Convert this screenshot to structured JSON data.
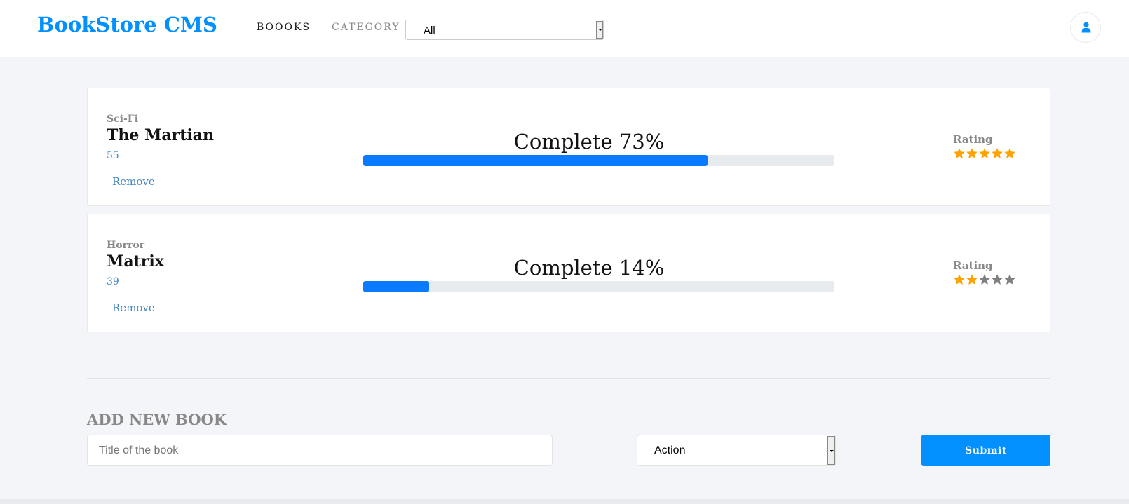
{
  "header": {
    "brand": "BookStore CMS",
    "nav_books": "BOOOKS",
    "nav_category": "CATEGORY",
    "category_filter_value": "All"
  },
  "books": [
    {
      "genre": "Sci-Fi",
      "title": "The Martian",
      "author": "55",
      "remove_label": "Remove",
      "progress_text": "Complete 73%",
      "progress_percent": 73,
      "rating_label": "Rating",
      "rating_stars_filled": 5,
      "rating_stars_total": 5
    },
    {
      "genre": "Horror",
      "title": "Matrix",
      "author": "39",
      "remove_label": "Remove",
      "progress_text": "Complete 14%",
      "progress_percent": 14,
      "rating_label": "Rating",
      "rating_stars_filled": 2,
      "rating_stars_total": 5
    }
  ],
  "add_form": {
    "heading": "ADD NEW BOOK",
    "title_placeholder": "Title of the book",
    "title_value": "",
    "category_value": "Action",
    "submit_label": "Submit"
  },
  "colors": {
    "brand": "#0290ff",
    "progress": "#0a7bff",
    "star_filled": "#ffa200",
    "star_empty": "#808080"
  },
  "icons": {
    "avatar": "user-icon",
    "star": "star-icon"
  }
}
